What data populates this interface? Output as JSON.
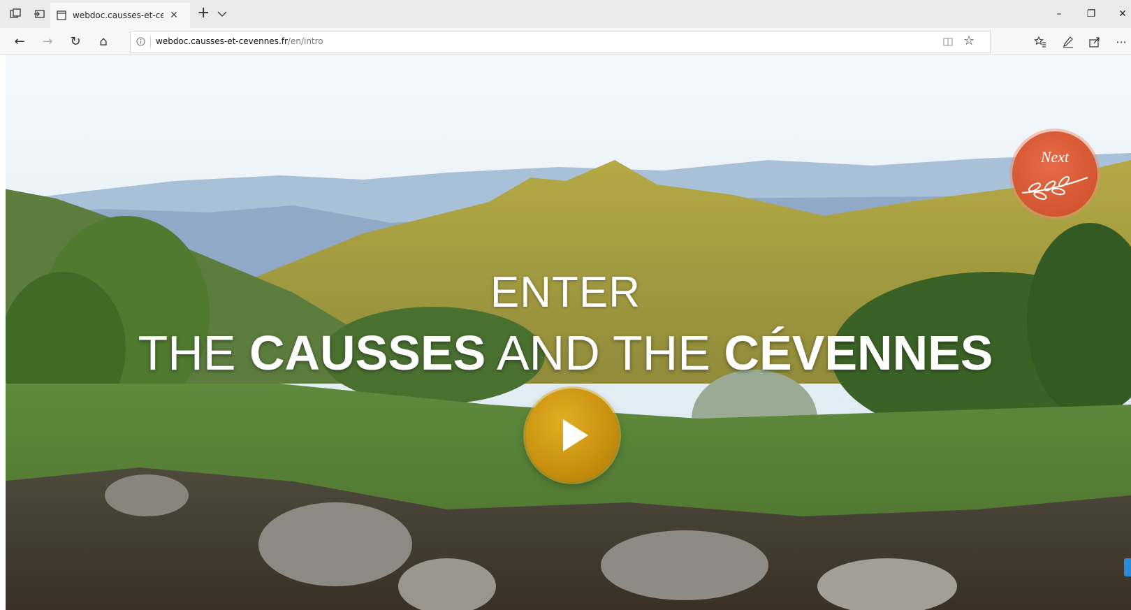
{
  "browser": {
    "tab": {
      "title": "webdoc.causses-et-ceve",
      "close_glyph": "✕"
    },
    "new_tab_glyph": "+",
    "window_controls": {
      "minimize": "–",
      "maximize": "❐",
      "close": "✕"
    },
    "nav": {
      "back": "←",
      "forward": "→",
      "refresh": "↻",
      "home": "⌂"
    },
    "address": {
      "host": "webdoc.causses-et-cevennes.fr",
      "path": "/en/intro"
    },
    "favorite_glyph": "☆",
    "more_glyph": "···"
  },
  "page": {
    "enter": "ENTER",
    "headline": {
      "the1": "THE ",
      "causses": "CAUSSES",
      "and_the": " AND THE ",
      "cevennes": "CÉVENNES"
    },
    "next_label": "Next",
    "play_icon": "play-icon"
  },
  "colors": {
    "play": "#c88f0d",
    "next": "#d45632",
    "hills_yellow": "#a9a03a",
    "sky": "#e9f3f8"
  }
}
